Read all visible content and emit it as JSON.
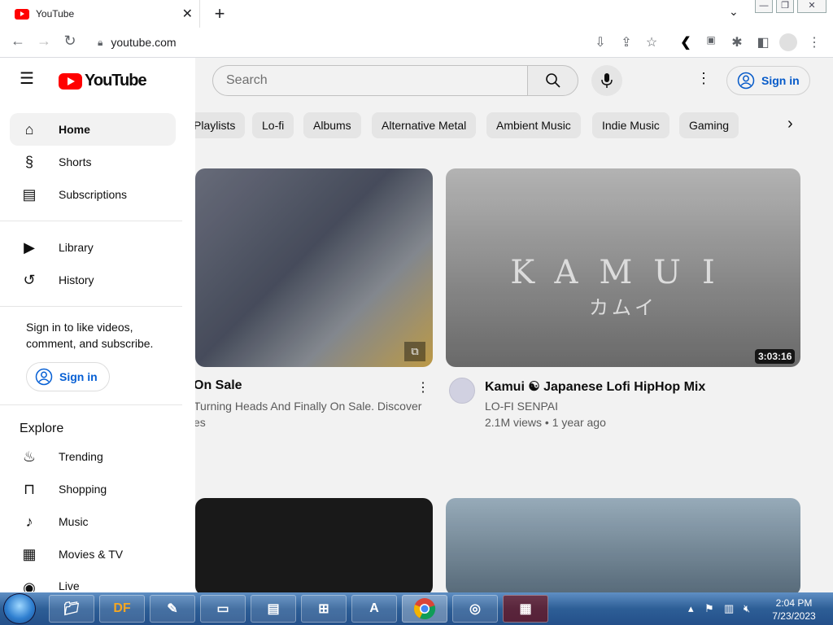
{
  "browser": {
    "tab_title": "YouTube",
    "tab_close": "✕",
    "new_tab": "+",
    "url": "youtube.com"
  },
  "header": {
    "search_placeholder": "Search",
    "sign_in": "Sign in"
  },
  "chips": [
    "Playlists",
    "Lo-fi",
    "Albums",
    "Alternative Metal",
    "Ambient Music",
    "Indie Music",
    "Gaming"
  ],
  "videos": [
    {
      "title": "On Sale",
      "meta1": "Turning Heads And Finally On Sale. Discover",
      "meta2": "es"
    },
    {
      "title": "Kamui ☯ Japanese Lofi HipHop Mix",
      "channel": "LO-FI SENPAI",
      "stats": "2.1M views • 1 year ago",
      "duration": "3:03:16",
      "thumb_text": "KAMUI",
      "thumb_sub": "カムイ"
    }
  ],
  "sidebar": {
    "logo_text": "YouTube",
    "items": [
      {
        "label": "Home",
        "icon": "home-icon",
        "glyph": "⌂"
      },
      {
        "label": "Shorts",
        "icon": "shorts-icon",
        "glyph": "§"
      },
      {
        "label": "Subscriptions",
        "icon": "subscriptions-icon",
        "glyph": "▤"
      },
      {
        "label": "Library",
        "icon": "library-icon",
        "glyph": "▶"
      },
      {
        "label": "History",
        "icon": "history-icon",
        "glyph": "↺"
      }
    ],
    "sign_in_prompt": "Sign in to like videos, comment, and subscribe.",
    "sign_in": "Sign in",
    "explore_heading": "Explore",
    "explore_items": [
      {
        "label": "Trending",
        "icon": "trending-icon",
        "glyph": "♨"
      },
      {
        "label": "Shopping",
        "icon": "shopping-icon",
        "glyph": "⊓"
      },
      {
        "label": "Music",
        "icon": "music-icon",
        "glyph": "♪"
      },
      {
        "label": "Movies & TV",
        "icon": "movies-icon",
        "glyph": "▦"
      },
      {
        "label": "Live",
        "icon": "live-icon",
        "glyph": "◉"
      }
    ]
  },
  "taskbar": {
    "time": "2:04 PM",
    "date": "7/23/2023",
    "df_label": "DF"
  },
  "colors": {
    "accent": "#065fd4",
    "brand": "#ff0000"
  }
}
